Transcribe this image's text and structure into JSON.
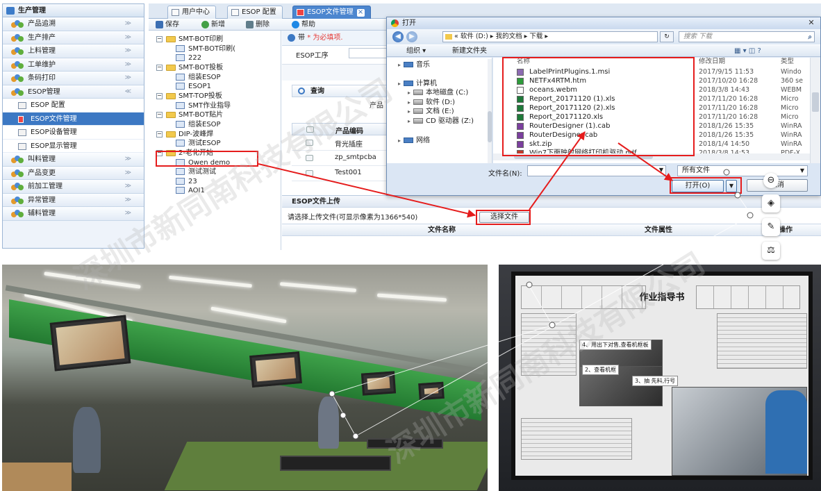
{
  "nav": {
    "title": "生产管理",
    "items": [
      "产品追溯",
      "生产排产",
      "上料管理",
      "工单维护",
      "条码打印"
    ],
    "esop": "ESOP管理",
    "esop_sub": [
      "ESOP 配置",
      "ESOP文件管理",
      "ESOP设备管理",
      "ESOP显示管理"
    ],
    "items2": [
      "叫料管理",
      "产品变更",
      "前加工管理",
      "异常管理",
      "辅料管理"
    ]
  },
  "tabs": [
    "用户中心",
    "ESOP 配置",
    "ESOP文件管理"
  ],
  "tab_close": "×",
  "toolbar": {
    "save": "保存",
    "add": "新增",
    "delete": "删除",
    "help": "帮助"
  },
  "tree": [
    {
      "t": "folder",
      "label": "SMT-BOT印刷"
    },
    {
      "t": "doc",
      "label": "SMT-BOT印刷("
    },
    {
      "t": "doc",
      "label": "222"
    },
    {
      "t": "folder",
      "label": "SMT-BOT投板"
    },
    {
      "t": "doc",
      "label": "组装ESOP"
    },
    {
      "t": "doc",
      "label": "ESOP1"
    },
    {
      "t": "folder",
      "label": "SMT-TOP投板"
    },
    {
      "t": "doc",
      "label": "SMT作业指导"
    },
    {
      "t": "folder",
      "label": "SMT-BOT贴片"
    },
    {
      "t": "doc",
      "label": "组装ESOP"
    },
    {
      "t": "folder",
      "label": "DIP-波峰焊"
    },
    {
      "t": "doc",
      "label": "测试ESOP"
    },
    {
      "t": "folder",
      "label": "2-老化开始"
    },
    {
      "t": "doc",
      "label": "Owen demo"
    },
    {
      "t": "doc",
      "label": "测试测试"
    },
    {
      "t": "doc",
      "label": "23"
    },
    {
      "t": "doc",
      "label": "AOI1"
    }
  ],
  "form": {
    "hint_prefix": "带",
    "hint_star": "*",
    "hint_suffix": "为必填项.",
    "esop_process_label": "ESOP工序",
    "query": "查询",
    "product_label": "产品",
    "grid_col_code": "产品编码",
    "grid_rows": [
      "背光插座",
      "zp_smtpcba",
      "Test001"
    ],
    "upload_title": "ESOP文件上传",
    "upload_hint": "请选择上传文件(可显示像素为1366*540)",
    "choose_file": "选择文件",
    "file_col_name": "文件名称",
    "file_col_attr": "文件属性",
    "file_col_op": "操作"
  },
  "dialog": {
    "title": "打开",
    "close": "✕",
    "back": "◀",
    "forward": "▶",
    "path": "« 软件 (D:) ▸ 我的文档 ▸ 下载 ▸",
    "refresh": "↻",
    "search_placeholder": "搜索 下载",
    "organize": "组织 ▾",
    "new_folder": "新建文件夹",
    "view_icons": "▦ ▾ ◫ ?",
    "left": [
      {
        "label": "音乐",
        "ind": 0
      },
      {
        "label": "计算机",
        "ind": 0
      },
      {
        "label": "本地磁盘 (C:)",
        "ind": 1
      },
      {
        "label": "软件 (D:)",
        "ind": 1
      },
      {
        "label": "文档 (E:)",
        "ind": 1
      },
      {
        "label": "CD 驱动器 (Z:)",
        "ind": 1
      },
      {
        "label": "网络",
        "ind": 0
      }
    ],
    "col_name": "名称",
    "col_date": "修改日期",
    "col_type": "类型",
    "files": [
      {
        "name": "LabelPrintPlugins.1.msi",
        "date": "2017/9/15 11:53",
        "type": "Windo",
        "color": "#8c6bb1"
      },
      {
        "name": "NETFx4RTM.htm",
        "date": "2017/10/20 16:28",
        "type": "360 se",
        "color": "#2e9b3a"
      },
      {
        "name": "oceans.webm",
        "date": "2018/3/8 14:43",
        "type": "WEBM",
        "color": "#ffffff"
      },
      {
        "name": "Report_20171120 (1).xls",
        "date": "2017/11/20 16:28",
        "type": "Micro",
        "color": "#1f7a3a"
      },
      {
        "name": "Report_20171120 (2).xls",
        "date": "2017/11/20 16:28",
        "type": "Micro",
        "color": "#1f7a3a"
      },
      {
        "name": "Report_20171120.xls",
        "date": "2017/11/20 16:28",
        "type": "Micro",
        "color": "#1f7a3a"
      },
      {
        "name": "RouterDesigner (1).cab",
        "date": "2018/1/26 15:35",
        "type": "WinRA",
        "color": "#7b3f9e"
      },
      {
        "name": "RouterDesigner.cab",
        "date": "2018/1/26 15:35",
        "type": "WinRA",
        "color": "#7b3f9e"
      },
      {
        "name": "skt.zip",
        "date": "2018/1/4 14:50",
        "type": "WinRA",
        "color": "#7b3f9e"
      },
      {
        "name": "Win7下面映射网络打印机驱动.pdf",
        "date": "2018/3/8 14:53",
        "type": "PDF-X",
        "color": "#c0392b"
      }
    ],
    "filename_label": "文件名(N):",
    "filetype": "所有文件",
    "open": "打开(O)",
    "open_drop": "▼",
    "cancel": "取消"
  },
  "side_tools": [
    "⊖",
    "◈",
    "✎",
    "⚖",
    "▣",
    "⎘",
    "···"
  ],
  "monitor": {
    "title": "作业指导书",
    "cap1": "4、用出下对售,查看机框板",
    "cap2": "2、查看机框",
    "cap3": "3、抽 先料,行号"
  },
  "watermark": "深圳市新同南科技有限公司"
}
